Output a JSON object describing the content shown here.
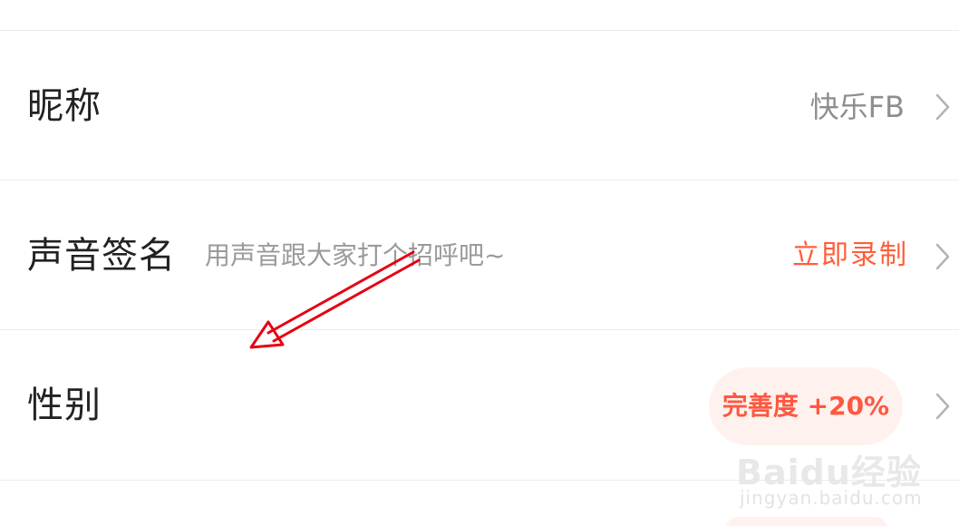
{
  "settings": {
    "nickname": {
      "label": "昵称",
      "value": "快乐FB"
    },
    "voice_signature": {
      "label": "声音签名",
      "hint": "用声音跟大家打个招呼吧~",
      "action": "立即录制"
    },
    "gender": {
      "label": "性别",
      "badge": "完善度 +20%"
    }
  },
  "watermark": {
    "logo_text": "Baidu经验",
    "url_text": "jingyan.baidu.com"
  },
  "colors": {
    "accent": "#ff5e3a",
    "badge_bg": "#fff2ee",
    "annotation_arrow": "#e60012"
  },
  "icons": {
    "chevron": "chevron-right-icon"
  }
}
